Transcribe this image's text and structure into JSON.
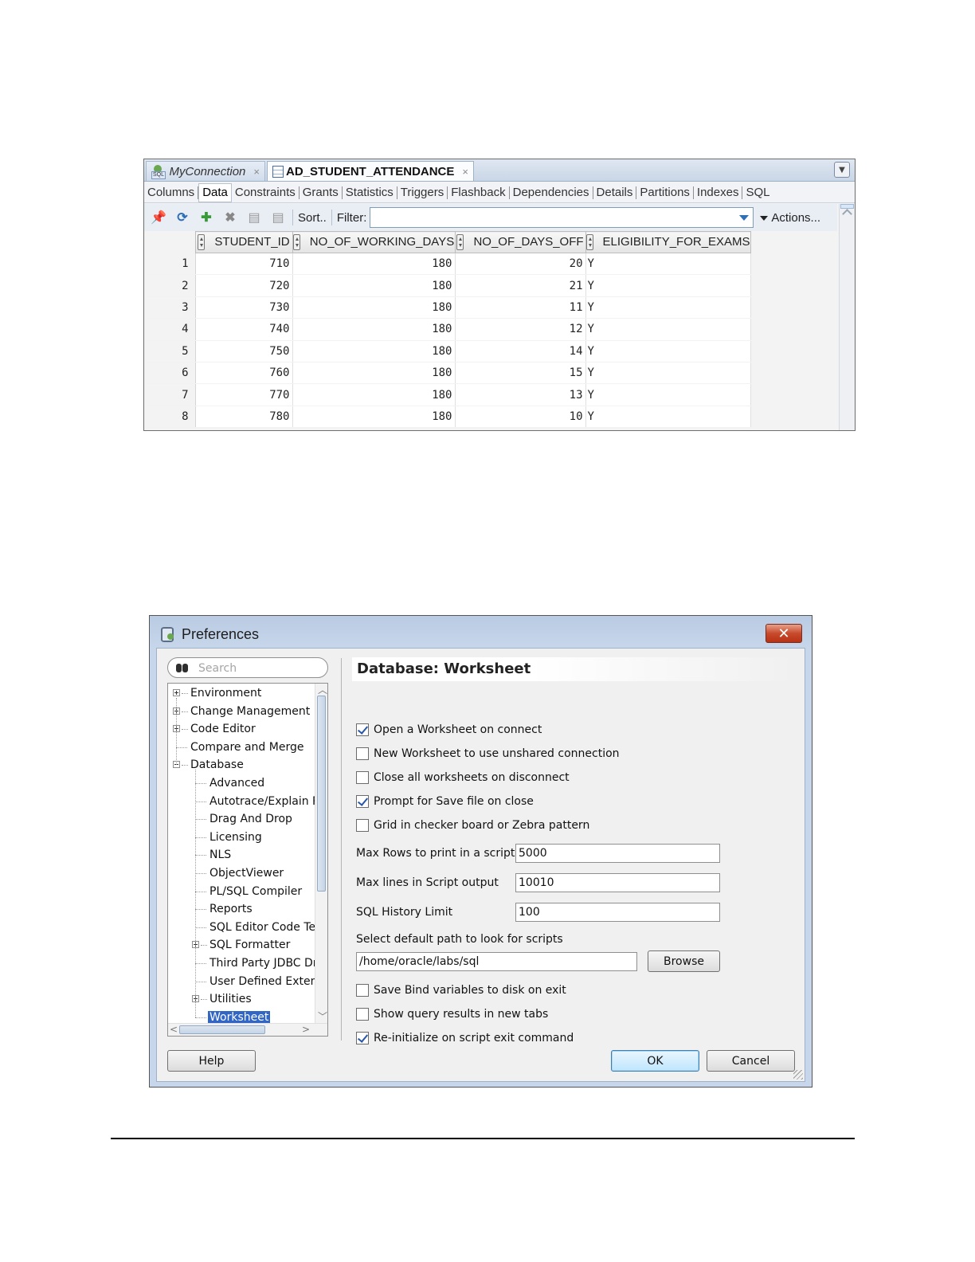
{
  "editor": {
    "tabs": [
      {
        "label": "MyConnection",
        "close": "×"
      },
      {
        "label": "AD_STUDENT_ATTENDANCE",
        "close": "×"
      }
    ],
    "subtabs": [
      "Columns",
      "Data",
      "Constraints",
      "Grants",
      "Statistics",
      "Triggers",
      "Flashback",
      "Dependencies",
      "Details",
      "Partitions",
      "Indexes",
      "SQL"
    ],
    "active_subtab": "Data",
    "toolbar": {
      "icons": [
        "pin-icon",
        "refresh-icon",
        "insert-row-icon",
        "delete-row-icon",
        "commit-icon",
        "rollback-icon"
      ],
      "sort_label": "Sort..",
      "filter_label": "Filter:",
      "filter_value": "",
      "actions_label": "Actions..."
    },
    "columns": [
      "STUDENT_ID",
      "NO_OF_WORKING_DAYS",
      "NO_OF_DAYS_OFF",
      "ELIGIBILITY_FOR_EXAMS"
    ],
    "rows": [
      {
        "n": "1",
        "student_id": "710",
        "working_days": "180",
        "days_off": "20",
        "eligible": "Y"
      },
      {
        "n": "2",
        "student_id": "720",
        "working_days": "180",
        "days_off": "21",
        "eligible": "Y"
      },
      {
        "n": "3",
        "student_id": "730",
        "working_days": "180",
        "days_off": "11",
        "eligible": "Y"
      },
      {
        "n": "4",
        "student_id": "740",
        "working_days": "180",
        "days_off": "12",
        "eligible": "Y"
      },
      {
        "n": "5",
        "student_id": "750",
        "working_days": "180",
        "days_off": "14",
        "eligible": "Y"
      },
      {
        "n": "6",
        "student_id": "760",
        "working_days": "180",
        "days_off": "15",
        "eligible": "Y"
      },
      {
        "n": "7",
        "student_id": "770",
        "working_days": "180",
        "days_off": "13",
        "eligible": "Y"
      },
      {
        "n": "8",
        "student_id": "780",
        "working_days": "180",
        "days_off": "10",
        "eligible": "Y"
      }
    ]
  },
  "preferences": {
    "title": "Preferences",
    "close_label": "✕",
    "search_placeholder": "Search",
    "tree": [
      {
        "label": "Environment"
      },
      {
        "label": "Change Management P"
      },
      {
        "label": "Code Editor"
      },
      {
        "label": "Compare and Merge"
      },
      {
        "label": "Database"
      },
      {
        "label": "Advanced"
      },
      {
        "label": "Autotrace/Explain P"
      },
      {
        "label": "Drag And Drop"
      },
      {
        "label": "Licensing"
      },
      {
        "label": "NLS"
      },
      {
        "label": "ObjectViewer"
      },
      {
        "label": "PL/SQL Compiler"
      },
      {
        "label": "Reports"
      },
      {
        "label": "SQL Editor Code Te"
      },
      {
        "label": "SQL Formatter"
      },
      {
        "label": "Third Party JDBC Dr"
      },
      {
        "label": "User Defined Extens"
      },
      {
        "label": "Utilities"
      },
      {
        "label": "Worksheet"
      }
    ],
    "selected_item": "Worksheet",
    "heading": "Database: Worksheet",
    "options_top": [
      {
        "label": "Open a Worksheet on connect",
        "checked": true
      },
      {
        "label": "New Worksheet to use unshared connection",
        "checked": false
      },
      {
        "label": "Close all worksheets on disconnect",
        "checked": false
      },
      {
        "label": "Prompt for Save file on close",
        "checked": true
      },
      {
        "label": "Grid in checker board or Zebra pattern",
        "checked": false
      }
    ],
    "fields": [
      {
        "label": "Max Rows to print in a script",
        "value": "5000"
      },
      {
        "label": "Max lines in Script output",
        "value": "10010"
      },
      {
        "label": "SQL History Limit",
        "value": "100"
      }
    ],
    "path_label": "Select default path to look for scripts",
    "path_value": "/home/oracle/labs/sql",
    "browse_label": "Browse",
    "options_bottom": [
      {
        "label": "Save Bind variables to disk on exit",
        "checked": false
      },
      {
        "label": "Show query results in new tabs",
        "checked": false
      },
      {
        "label": "Re-initialize on script exit command",
        "checked": true
      }
    ],
    "help_label": "Help",
    "ok_label": "OK",
    "cancel_label": "Cancel"
  }
}
